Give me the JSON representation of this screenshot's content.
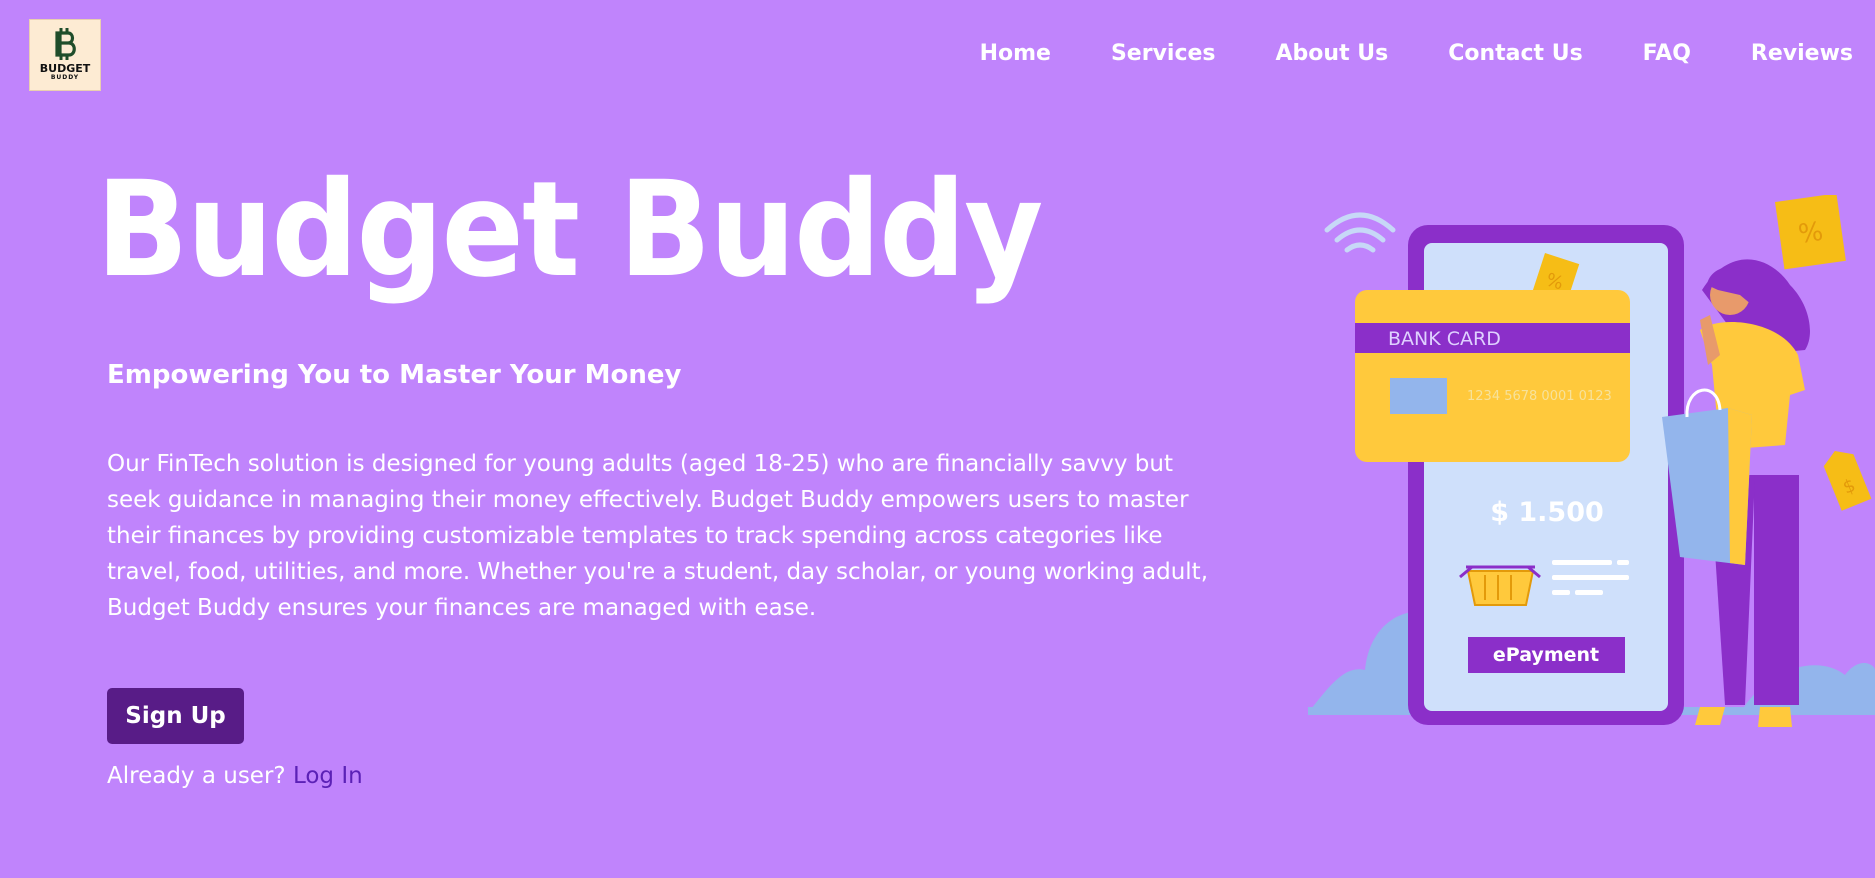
{
  "brand": {
    "logo_icon": "bitcoin-b-icon",
    "logo_word": "BUDGET",
    "logo_sub": "BUDDY"
  },
  "nav": {
    "items": [
      "Home",
      "Services",
      "About Us",
      "Contact Us",
      "FAQ",
      "Reviews"
    ]
  },
  "hero": {
    "title": "Budget Buddy",
    "tagline": "Empowering You to Master Your Money",
    "description": "Our FinTech solution is designed for young adults (aged 18-25) who are financially savvy but seek guidance in managing their money effectively. Budget Buddy empowers users to master their finances by providing customizable templates to track spending across categories like travel, food, utilities, and more. Whether you're a student, day scholar, or young working adult, Budget Buddy ensures your finances are managed with ease.",
    "signup_label": "Sign Up",
    "login_prompt": "Already a user?",
    "login_link": "Log In"
  },
  "illustration": {
    "card_label": "BANK CARD",
    "card_number": "1234 5678 0001 0123",
    "amount": "$ 1.500",
    "payment_label": "ePayment",
    "tag_symbol": "%",
    "price_tag_symbol": "$"
  },
  "colors": {
    "background": "#c084fc",
    "button": "#581c87",
    "link": "#5b21b6",
    "phone_frame": "#8b2fc9",
    "card": "#ffc93c"
  }
}
